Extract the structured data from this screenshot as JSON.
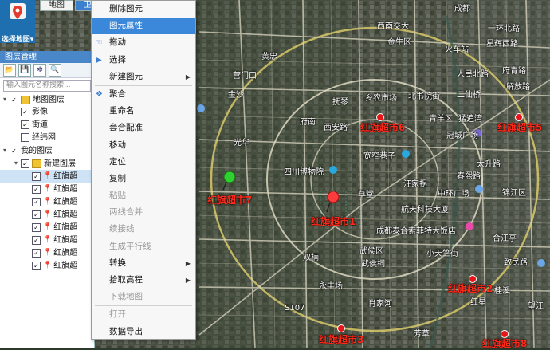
{
  "app": {
    "logo_text": "选择地图▾"
  },
  "map_tabs": [
    {
      "label": "地图"
    },
    {
      "label": "卫"
    }
  ],
  "colors": {
    "accent": "#3b87d9",
    "poi": "#ff2a1a"
  },
  "layer_panel": {
    "title": "图层管理",
    "search_placeholder": "输入图元名称搜索...",
    "tree": [
      {
        "label": "地图图层",
        "level": 0,
        "checked": true,
        "expanded": true,
        "icon": "folder"
      },
      {
        "label": "影像",
        "level": 1,
        "checked": true
      },
      {
        "label": "街道",
        "level": 1,
        "checked": true
      },
      {
        "label": "经纬网",
        "level": 1,
        "checked": false
      },
      {
        "label": "我的图层",
        "level": 0,
        "checked": true,
        "expanded": true
      },
      {
        "label": "新建图层",
        "level": 1,
        "checked": true,
        "expanded": true,
        "icon": "folder"
      },
      {
        "label": "红旗超",
        "level": 2,
        "checked": true,
        "selected": true,
        "icon": "pin"
      },
      {
        "label": "红旗超",
        "level": 2,
        "checked": true,
        "icon": "pin"
      },
      {
        "label": "红旗超",
        "level": 2,
        "checked": true,
        "icon": "pin"
      },
      {
        "label": "红旗超",
        "level": 2,
        "checked": true,
        "icon": "pin"
      },
      {
        "label": "红旗超",
        "level": 2,
        "checked": true,
        "icon": "pin"
      },
      {
        "label": "红旗超",
        "level": 2,
        "checked": true,
        "icon": "pin"
      },
      {
        "label": "红旗超",
        "level": 2,
        "checked": true,
        "icon": "pin"
      },
      {
        "label": "红旗超",
        "level": 2,
        "checked": true,
        "icon": "pin"
      }
    ]
  },
  "context_menu": [
    {
      "label": "删除图元"
    },
    {
      "label": "图元属性",
      "highlighted": true
    },
    {
      "label": "拖动",
      "icon": "hand-icon"
    },
    {
      "label": "选择",
      "icon": "pointer-icon"
    },
    {
      "label": "新建图元",
      "submenu": true
    },
    {
      "separator": true
    },
    {
      "label": "聚合",
      "icon": "cluster-icon"
    },
    {
      "label": "重命名"
    },
    {
      "label": "套合配准"
    },
    {
      "label": "移动"
    },
    {
      "label": "定位"
    },
    {
      "label": "复制"
    },
    {
      "label": "粘贴",
      "disabled": true
    },
    {
      "label": "两线合并",
      "disabled": true
    },
    {
      "label": "续接线",
      "disabled": true
    },
    {
      "label": "生成平行线",
      "disabled": true
    },
    {
      "label": "转换",
      "submenu": true
    },
    {
      "label": "拾取高程",
      "submenu": true
    },
    {
      "label": "下载地图",
      "disabled": true
    },
    {
      "separator": true
    },
    {
      "label": "打开",
      "disabled": true
    },
    {
      "label": "数据导出"
    }
  ],
  "map_labels": [
    "西南交大",
    "金牛区",
    "成都",
    "一环北路",
    "火车站",
    "星辉西路",
    "府青路",
    "黄忠",
    "营门口",
    "人民北路",
    "解放路",
    "金沙",
    "抚琴",
    "乡农市场",
    "北书院街",
    "二仙桥",
    "府南",
    "西安路",
    "青羊区",
    "猛追湾",
    "光华",
    "宽窄巷子",
    "冠城广场",
    "太升路",
    "春熙路",
    "锦江区",
    "四川博物院",
    "草堂",
    "汪家拐",
    "中环广场",
    "航天科技大厦",
    "成都泰合索菲特大饭店",
    "武侯区",
    "武侯祠",
    "小天竺街",
    "双楠",
    "永丰场",
    "桂溪",
    "合江亭",
    "致民路",
    "肖家河",
    "芳草",
    "望江",
    "S107",
    "红星"
  ],
  "markers": [
    {
      "label": "红旗超市6"
    },
    {
      "label": "红旗超市5"
    },
    {
      "label": "红旗超市7"
    },
    {
      "label": "红旗超市1"
    },
    {
      "label": "红旗超市2"
    },
    {
      "label": "红旗超市3"
    },
    {
      "label": "红旗超市8"
    }
  ]
}
